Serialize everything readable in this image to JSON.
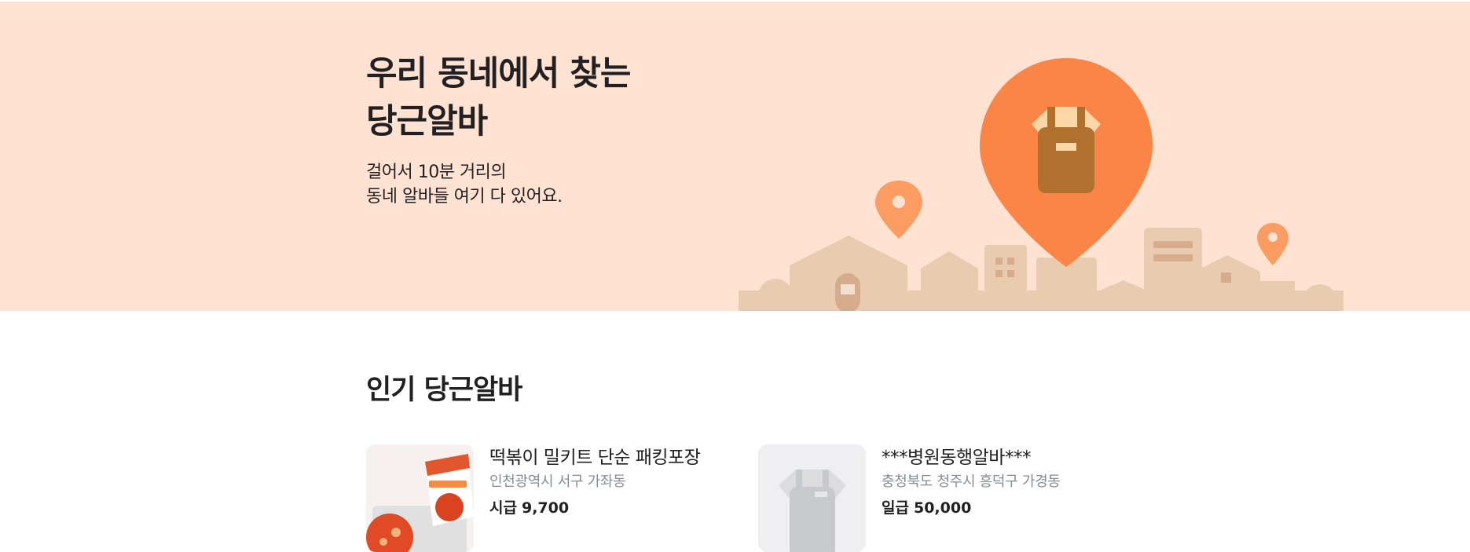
{
  "hero": {
    "title_line1": "우리 동네에서 찾는",
    "title_line2": "당근알바",
    "subtitle_line1": "걸어서 10분 거리의",
    "subtitle_line2": "동네 알바들 여기 다 있어요."
  },
  "popular": {
    "title": "인기 당근알바",
    "jobs": [
      {
        "title": "떡볶이 밀키트 단순 패킹포장",
        "location": "인천광역시 서구 가좌동",
        "pay_type": "시급",
        "pay_amount": "9,700",
        "thumbnail_icon": "tteokbokki-product-photo"
      },
      {
        "title": "***병원동행알바***",
        "location": "충청북도 청주시 흥덕구 가경동",
        "pay_type": "일급",
        "pay_amount": "50,000",
        "thumbnail_icon": "apron-placeholder-icon"
      }
    ]
  },
  "colors": {
    "hero_bg": "#ffe2d2",
    "brand_orange": "#fc8548",
    "town_beige": "#e9cbb0",
    "text_primary": "#212124",
    "text_secondary": "#868b94"
  }
}
